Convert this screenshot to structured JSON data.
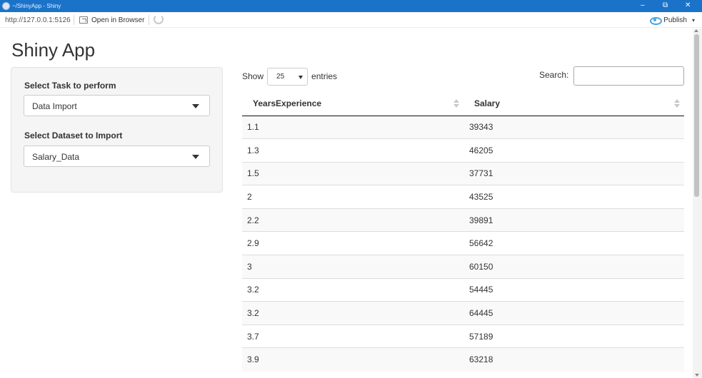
{
  "window": {
    "title": "~/ShinyApp - Shiny",
    "minimize_glyph": "–",
    "restore_glyph": "⧉",
    "close_glyph": "✕"
  },
  "toolbar": {
    "url": "http://127.0.0.1:5126",
    "open_in_browser": "Open in Browser",
    "publish": "Publish",
    "publish_caret": "▾",
    "accent_color": "#4aa3df"
  },
  "app": {
    "title": "Shiny App"
  },
  "sidebar": {
    "task_label": "Select Task to perform",
    "task_value": "Data Import",
    "dataset_label": "Select Dataset to Import",
    "dataset_value": "Salary_Data"
  },
  "datatable": {
    "show_label": "Show",
    "page_length": "25",
    "entries_label": "entries",
    "search_label": "Search:",
    "search_value": "",
    "columns": [
      "YearsExperience",
      "Salary"
    ],
    "rows": [
      [
        "1.1",
        "39343"
      ],
      [
        "1.3",
        "46205"
      ],
      [
        "1.5",
        "37731"
      ],
      [
        "2",
        "43525"
      ],
      [
        "2.2",
        "39891"
      ],
      [
        "2.9",
        "56642"
      ],
      [
        "3",
        "60150"
      ],
      [
        "3.2",
        "54445"
      ],
      [
        "3.2",
        "64445"
      ],
      [
        "3.7",
        "57189"
      ],
      [
        "3.9",
        "63218"
      ]
    ]
  }
}
